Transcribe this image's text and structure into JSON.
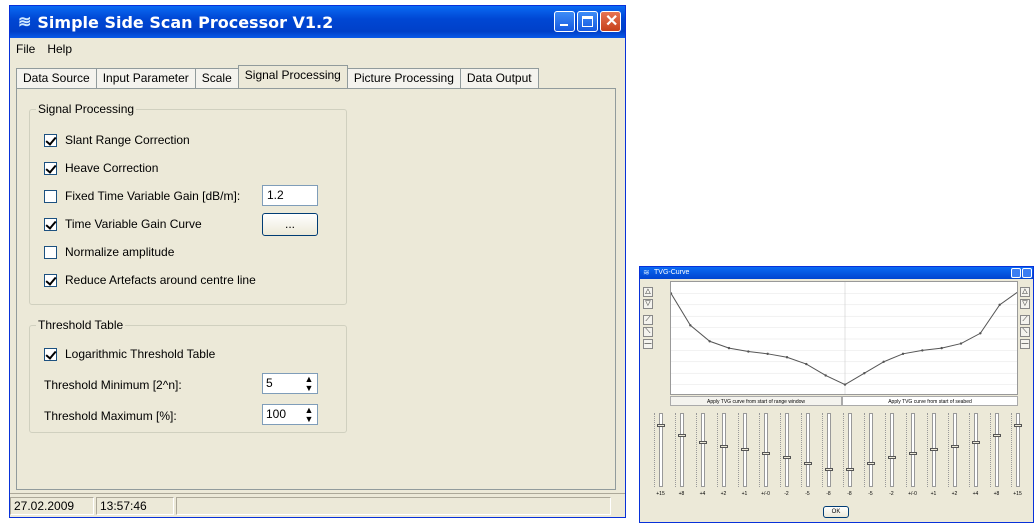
{
  "main_window": {
    "title": "Simple Side Scan Processor V1.2",
    "menu": [
      "File",
      "Help"
    ],
    "tabs": [
      "Data Source",
      "Input Parameter",
      "Scale",
      "Signal Processing",
      "Picture Processing",
      "Data Output"
    ],
    "active_tab": "Signal Processing",
    "signal_group": {
      "title": "Signal Processing",
      "slant": {
        "label": "Slant Range Correction",
        "checked": true
      },
      "heave": {
        "label": "Heave Correction",
        "checked": true
      },
      "fixed_tvg": {
        "label": "Fixed Time Variable Gain [dB/m]:",
        "checked": false,
        "value": "1.2"
      },
      "tvg_curve": {
        "label": "Time Variable Gain Curve",
        "checked": true,
        "button": "..."
      },
      "normalize": {
        "label": "Normalize amplitude",
        "checked": false
      },
      "artefacts": {
        "label": "Reduce Artefacts around centre line",
        "checked": true
      }
    },
    "threshold_group": {
      "title": "Threshold Table",
      "log": {
        "label": "Logarithmic Threshold Table",
        "checked": true
      },
      "min": {
        "label": "Threshold Minimum [2^n]:",
        "value": "5"
      },
      "max": {
        "label": "Threshold Maximum [%]:",
        "value": "100"
      }
    },
    "status": {
      "date": "27.02.2009",
      "time": "13:57:46"
    }
  },
  "tvg_window": {
    "title": "TVG-Curve",
    "tab_left": "Apply TVG curve from start of range window",
    "tab_right": "Apply TVG curve from start of seabed",
    "slider_labels": [
      "+15",
      "+8",
      "+4",
      "+2",
      "+1",
      "+/-0",
      "-2",
      "-5",
      "-8",
      "-8",
      "-5",
      "-2",
      "+/-0",
      "+1",
      "+2",
      "+4",
      "+8",
      "+15"
    ],
    "slider_levels": [
      0.15,
      0.3,
      0.4,
      0.45,
      0.5,
      0.55,
      0.62,
      0.7,
      0.78,
      0.78,
      0.7,
      0.62,
      0.55,
      0.5,
      0.45,
      0.4,
      0.3,
      0.15
    ],
    "curve": [
      0.1,
      0.38,
      0.52,
      0.58,
      0.61,
      0.63,
      0.66,
      0.72,
      0.82,
      0.9,
      0.8,
      0.7,
      0.63,
      0.6,
      0.58,
      0.54,
      0.45,
      0.2,
      0.08
    ],
    "ok": "OK"
  },
  "colors": {
    "titlebar": "#0a5ae8",
    "window_bg": "#ece9d8",
    "curve": "#555555"
  }
}
